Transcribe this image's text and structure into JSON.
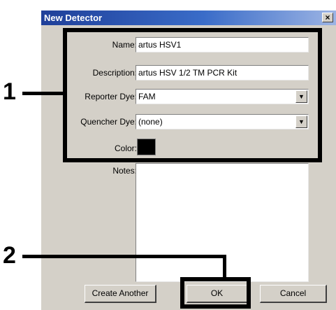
{
  "dialog": {
    "title": "New Detector",
    "close_glyph": "×"
  },
  "form": {
    "name_label": "Name:",
    "name_value": "artus HSV1",
    "description_label": "Description:",
    "description_value": "artus HSV 1/2 TM PCR Kit",
    "reporter_label": "Reporter Dye:",
    "reporter_value": "FAM",
    "quencher_label": "Quencher Dye:",
    "quencher_value": "(none)",
    "color_label": "Color:",
    "color_value": "#000000",
    "notes_label": "Notes:",
    "notes_value": ""
  },
  "buttons": {
    "create_another": "Create Another",
    "ok": "OK",
    "cancel": "Cancel"
  },
  "annotations": {
    "callout_1": "1",
    "callout_2": "2"
  },
  "icons": {
    "close": "close-icon",
    "dropdown": "chevron-down-icon"
  }
}
